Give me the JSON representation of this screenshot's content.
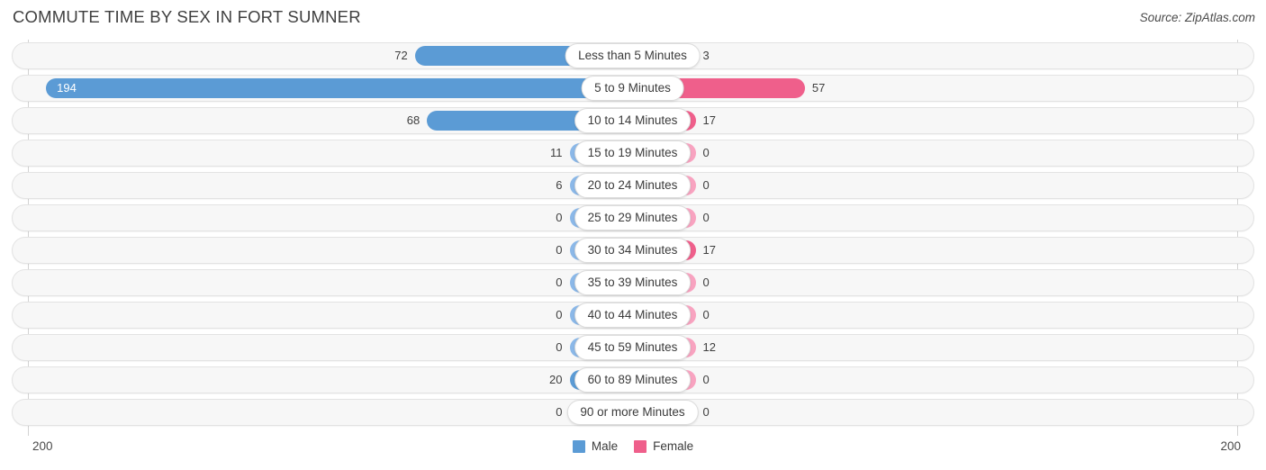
{
  "header": {
    "title": "COMMUTE TIME BY SEX IN FORT SUMNER",
    "source": "Source: ZipAtlas.com"
  },
  "legend": {
    "male_label": "Male",
    "female_label": "Female",
    "male_color": "#5b9bd5",
    "female_color": "#ef5f8b"
  },
  "axis": {
    "left_tick": "200",
    "right_tick": "200",
    "max": 200
  },
  "chart_data": {
    "type": "bar",
    "title": "COMMUTE TIME BY SEX IN FORT SUMNER",
    "subtitle": "Source: ZipAtlas.com",
    "orientation": "horizontal-diverging",
    "xlabel": "",
    "ylabel": "",
    "xlim": [
      200,
      200
    ],
    "grid": false,
    "legend_position": "bottom-center",
    "categories": [
      "Less than 5 Minutes",
      "5 to 9 Minutes",
      "10 to 14 Minutes",
      "15 to 19 Minutes",
      "20 to 24 Minutes",
      "25 to 29 Minutes",
      "30 to 34 Minutes",
      "35 to 39 Minutes",
      "40 to 44 Minutes",
      "45 to 59 Minutes",
      "60 to 89 Minutes",
      "90 or more Minutes"
    ],
    "series": [
      {
        "name": "Male",
        "color": "#5b9bd5",
        "values": [
          72,
          194,
          68,
          11,
          6,
          0,
          0,
          0,
          0,
          0,
          20,
          0
        ]
      },
      {
        "name": "Female",
        "color": "#ef5f8b",
        "values": [
          3,
          57,
          17,
          0,
          0,
          0,
          17,
          0,
          0,
          12,
          0,
          0
        ]
      }
    ]
  },
  "rows": [
    {
      "label": "Less than 5 Minutes",
      "male": "72",
      "female": "3"
    },
    {
      "label": "5 to 9 Minutes",
      "male": "194",
      "female": "57"
    },
    {
      "label": "10 to 14 Minutes",
      "male": "68",
      "female": "17"
    },
    {
      "label": "15 to 19 Minutes",
      "male": "11",
      "female": "0"
    },
    {
      "label": "20 to 24 Minutes",
      "male": "6",
      "female": "0"
    },
    {
      "label": "25 to 29 Minutes",
      "male": "0",
      "female": "0"
    },
    {
      "label": "30 to 34 Minutes",
      "male": "0",
      "female": "17"
    },
    {
      "label": "35 to 39 Minutes",
      "male": "0",
      "female": "0"
    },
    {
      "label": "40 to 44 Minutes",
      "male": "0",
      "female": "0"
    },
    {
      "label": "45 to 59 Minutes",
      "male": "0",
      "female": "12"
    },
    {
      "label": "60 to 89 Minutes",
      "male": "20",
      "female": "0"
    },
    {
      "label": "90 or more Minutes",
      "male": "0",
      "female": "0"
    }
  ]
}
